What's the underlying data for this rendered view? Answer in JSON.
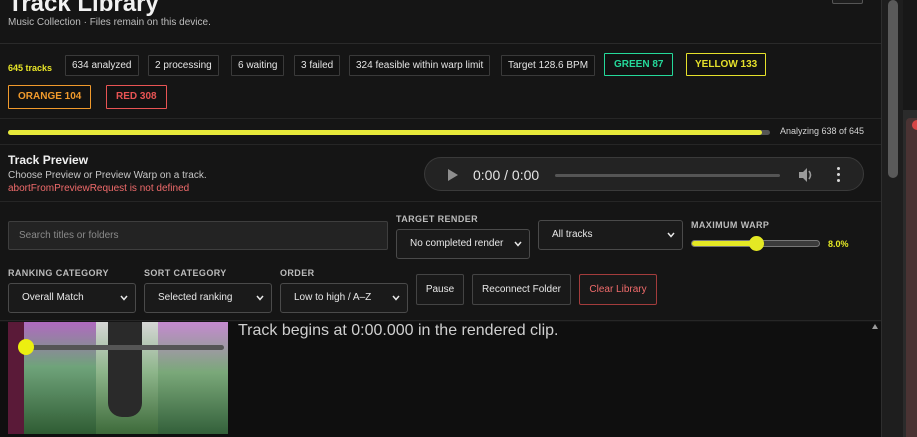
{
  "header": {
    "title": "Track Library",
    "subtitle": "Music Collection · Files remain on this device."
  },
  "stats": {
    "tracks": "645 tracks",
    "analyzed": "634 analyzed",
    "processing": "2 processing",
    "waiting": "6 waiting",
    "failed": "3 failed",
    "feasible": "324 feasible within warp limit",
    "target": "Target 128.6 BPM",
    "green": "GREEN 87",
    "yellow": "YELLOW 133",
    "orange": "ORANGE 104",
    "red": "RED 308"
  },
  "progress": {
    "fraction": 0.989,
    "label": "Analyzing 638 of 645"
  },
  "preview": {
    "title": "Track Preview",
    "subtitle": "Choose Preview or Preview Warp on a track.",
    "error": "abortFromPreviewRequest is not defined",
    "time": "0:00 / 0:00"
  },
  "controls": {
    "search_placeholder": "Search titles or folders",
    "target_render_label": "TARGET RENDER",
    "target_render_value": "No completed render",
    "tracks_filter_value": "All tracks",
    "max_warp_label": "MAXIMUM WARP",
    "max_warp_value": "8.0%",
    "max_warp_fraction": 0.5,
    "ranking_label": "RANKING CATEGORY",
    "ranking_value": "Overall Match",
    "sort_label": "SORT CATEGORY",
    "sort_value": "Selected ranking",
    "order_label": "ORDER",
    "order_value": "Low to high / A–Z",
    "pause_label": "Pause",
    "reconnect_label": "Reconnect Folder",
    "clear_label": "Clear Library"
  },
  "list": {
    "row_text": "Track begins at 0:00.000 in the rendered clip."
  },
  "colors": {
    "accent_yellow": "#e4e824",
    "green": "#25d99a",
    "orange": "#f09a2c",
    "red": "#e85454"
  }
}
